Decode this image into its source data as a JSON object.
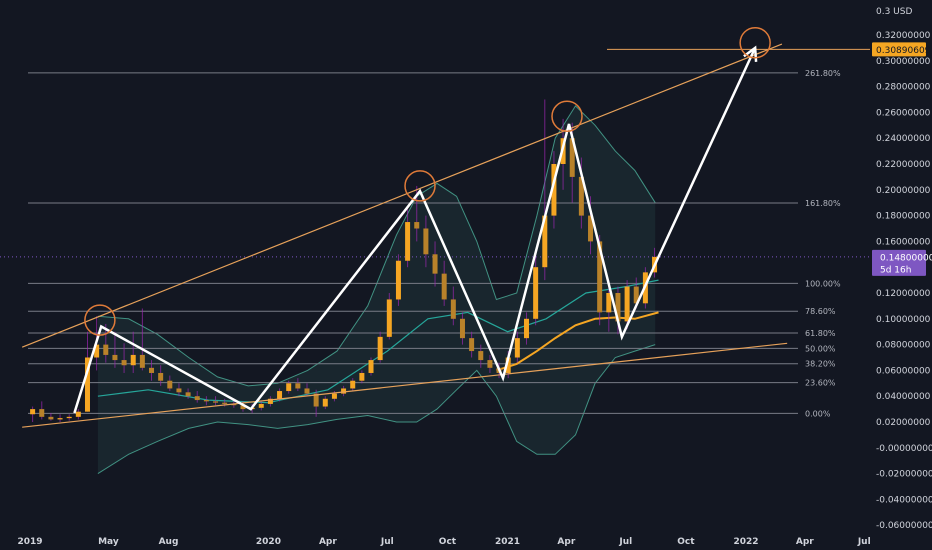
{
  "chart_data": {
    "type": "candlestick",
    "title": "",
    "xlabel": "",
    "ylabel": "",
    "currency": "USD",
    "ylim": [
      -0.066,
      0.3
    ],
    "y_ticks": [
      {
        "value": 0.3,
        "label": "0.3"
      },
      {
        "value": 0.32,
        "label": "0.32000000"
      },
      {
        "value": 0.3,
        "label": "0.30000000"
      },
      {
        "value": 0.28,
        "label": "0.28000000"
      },
      {
        "value": 0.26,
        "label": "0.26000000"
      },
      {
        "value": 0.24,
        "label": "0.24000000"
      },
      {
        "value": 0.22,
        "label": "0.22000000"
      },
      {
        "value": 0.2,
        "label": "0.20000000"
      },
      {
        "value": 0.18,
        "label": "0.18000000"
      },
      {
        "value": 0.16,
        "label": "0.16000000"
      },
      {
        "value": 0.12,
        "label": "0.12000000"
      },
      {
        "value": 0.1,
        "label": "0.10000000"
      },
      {
        "value": 0.08,
        "label": "0.08000000"
      },
      {
        "value": 0.06,
        "label": "0.06000000"
      },
      {
        "value": 0.04,
        "label": "0.04000000"
      },
      {
        "value": 0.02,
        "label": "0.02000000"
      },
      {
        "value": -0.0,
        "label": "-0.00000000"
      },
      {
        "value": -0.02,
        "label": "-0.02000000"
      },
      {
        "value": -0.04,
        "label": "-0.04000000"
      },
      {
        "value": -0.06,
        "label": "-0.06000000"
      }
    ],
    "x_ticks": [
      "2019",
      "May",
      "Aug",
      "2020",
      "Apr",
      "Jul",
      "Oct",
      "2021",
      "Apr",
      "Jul",
      "Oct",
      "2022",
      "Apr",
      "Jul"
    ],
    "x_tick_dates": [
      "2019-01-01",
      "2019-05-01",
      "2019-08-01",
      "2020-01-01",
      "2020-04-01",
      "2020-07-01",
      "2020-10-01",
      "2021-01-01",
      "2021-04-01",
      "2021-07-01",
      "2021-10-01",
      "2022-01-01",
      "2022-04-01",
      "2022-07-01"
    ],
    "fib_levels": [
      {
        "label": "261.80%",
        "value": 0.2906
      },
      {
        "label": "161.80%",
        "value": 0.1898
      },
      {
        "label": "100.00%",
        "value": 0.1275
      },
      {
        "label": "78.60%",
        "value": 0.1059
      },
      {
        "label": "61.80%",
        "value": 0.089
      },
      {
        "label": "50.00%",
        "value": 0.0771
      },
      {
        "label": "38.20%",
        "value": 0.0652
      },
      {
        "label": "23.60%",
        "value": 0.0505
      },
      {
        "label": "0.00%",
        "value": 0.0267
      }
    ],
    "target_price": {
      "label": "0.30890609",
      "value": 0.3089
    },
    "current_price": {
      "label": "0.14800000",
      "value": 0.148,
      "countdown": "5d 16h"
    },
    "zigzag": [
      {
        "date": "2019-03-10",
        "value": 0.027
      },
      {
        "date": "2019-04-20",
        "value": 0.094
      },
      {
        "date": "2019-12-05",
        "value": 0.03
      },
      {
        "date": "2020-08-20",
        "value": 0.199
      },
      {
        "date": "2020-12-25",
        "value": 0.054
      },
      {
        "date": "2021-04-05",
        "value": 0.251
      },
      {
        "date": "2021-06-25",
        "value": 0.086
      },
      {
        "date": "2021-08-20",
        "value": 0.148
      },
      {
        "date": "2022-01-15",
        "value": 0.31
      }
    ],
    "trendlines": [
      {
        "name": "upper",
        "from": {
          "date": "2018-12-20",
          "value": 0.078
        },
        "to": {
          "date": "2022-02-25",
          "value": 0.313
        }
      },
      {
        "name": "lower",
        "from": {
          "date": "2018-12-20",
          "value": 0.016
        },
        "to": {
          "date": "2022-03-05",
          "value": 0.081
        }
      }
    ],
    "circles": [
      {
        "date": "2019-04-18",
        "value": 0.099
      },
      {
        "date": "2020-08-20",
        "value": 0.203
      },
      {
        "date": "2021-04-02",
        "value": 0.257
      },
      {
        "date": "2022-01-15",
        "value": 0.314
      }
    ],
    "bollinger_upper": [
      {
        "date": "2019-04-15",
        "value": 0.102
      },
      {
        "date": "2019-06-01",
        "value": 0.1
      },
      {
        "date": "2019-07-15",
        "value": 0.088
      },
      {
        "date": "2019-09-01",
        "value": 0.07
      },
      {
        "date": "2019-10-15",
        "value": 0.055
      },
      {
        "date": "2019-12-01",
        "value": 0.048
      },
      {
        "date": "2020-01-15",
        "value": 0.05
      },
      {
        "date": "2020-03-01",
        "value": 0.06
      },
      {
        "date": "2020-04-15",
        "value": 0.075
      },
      {
        "date": "2020-06-01",
        "value": 0.11
      },
      {
        "date": "2020-07-15",
        "value": 0.165
      },
      {
        "date": "2020-08-15",
        "value": 0.195
      },
      {
        "date": "2020-09-15",
        "value": 0.205
      },
      {
        "date": "2020-10-15",
        "value": 0.195
      },
      {
        "date": "2020-11-15",
        "value": 0.16
      },
      {
        "date": "2020-12-15",
        "value": 0.115
      },
      {
        "date": "2021-01-15",
        "value": 0.12
      },
      {
        "date": "2021-02-15",
        "value": 0.18
      },
      {
        "date": "2021-03-15",
        "value": 0.24
      },
      {
        "date": "2021-04-15",
        "value": 0.265
      },
      {
        "date": "2021-05-15",
        "value": 0.25
      },
      {
        "date": "2021-06-15",
        "value": 0.23
      },
      {
        "date": "2021-07-15",
        "value": 0.215
      },
      {
        "date": "2021-08-15",
        "value": 0.19
      }
    ],
    "bollinger_lower": [
      {
        "date": "2019-04-15",
        "value": -0.02
      },
      {
        "date": "2019-06-01",
        "value": -0.005
      },
      {
        "date": "2019-07-15",
        "value": 0.005
      },
      {
        "date": "2019-09-01",
        "value": 0.015
      },
      {
        "date": "2019-10-15",
        "value": 0.02
      },
      {
        "date": "2019-12-01",
        "value": 0.018
      },
      {
        "date": "2020-01-15",
        "value": 0.015
      },
      {
        "date": "2020-03-01",
        "value": 0.018
      },
      {
        "date": "2020-04-15",
        "value": 0.022
      },
      {
        "date": "2020-06-01",
        "value": 0.025
      },
      {
        "date": "2020-07-15",
        "value": 0.02
      },
      {
        "date": "2020-08-15",
        "value": 0.02
      },
      {
        "date": "2020-09-15",
        "value": 0.03
      },
      {
        "date": "2020-10-15",
        "value": 0.045
      },
      {
        "date": "2020-11-15",
        "value": 0.06
      },
      {
        "date": "2020-12-15",
        "value": 0.04
      },
      {
        "date": "2021-01-15",
        "value": 0.005
      },
      {
        "date": "2021-02-15",
        "value": -0.005
      },
      {
        "date": "2021-03-15",
        "value": -0.005
      },
      {
        "date": "2021-04-15",
        "value": 0.01
      },
      {
        "date": "2021-05-15",
        "value": 0.05
      },
      {
        "date": "2021-06-15",
        "value": 0.07
      },
      {
        "date": "2021-07-15",
        "value": 0.075
      },
      {
        "date": "2021-08-15",
        "value": 0.08
      }
    ],
    "ma_teal": [
      {
        "date": "2019-04-15",
        "value": 0.04
      },
      {
        "date": "2019-07-01",
        "value": 0.045
      },
      {
        "date": "2019-10-01",
        "value": 0.037
      },
      {
        "date": "2020-01-01",
        "value": 0.035
      },
      {
        "date": "2020-04-01",
        "value": 0.045
      },
      {
        "date": "2020-07-01",
        "value": 0.075
      },
      {
        "date": "2020-09-01",
        "value": 0.1
      },
      {
        "date": "2020-11-01",
        "value": 0.105
      },
      {
        "date": "2021-01-01",
        "value": 0.09
      },
      {
        "date": "2021-03-01",
        "value": 0.1
      },
      {
        "date": "2021-05-01",
        "value": 0.12
      },
      {
        "date": "2021-07-01",
        "value": 0.125
      },
      {
        "date": "2021-08-20",
        "value": 0.13
      }
    ],
    "ma_orange": [
      {
        "date": "2020-12-15",
        "value": 0.06
      },
      {
        "date": "2021-01-15",
        "value": 0.065
      },
      {
        "date": "2021-02-15",
        "value": 0.075
      },
      {
        "date": "2021-03-15",
        "value": 0.085
      },
      {
        "date": "2021-04-15",
        "value": 0.095
      },
      {
        "date": "2021-05-15",
        "value": 0.1
      },
      {
        "date": "2021-06-15",
        "value": 0.101
      },
      {
        "date": "2021-07-15",
        "value": 0.1
      },
      {
        "date": "2021-08-20",
        "value": 0.105
      }
    ],
    "candles": [
      {
        "date": "2019-01-05",
        "o": 0.026,
        "h": 0.032,
        "l": 0.02,
        "c": 0.03
      },
      {
        "date": "2019-01-19",
        "o": 0.03,
        "h": 0.036,
        "l": 0.022,
        "c": 0.024
      },
      {
        "date": "2019-02-02",
        "o": 0.024,
        "h": 0.027,
        "l": 0.021,
        "c": 0.022
      },
      {
        "date": "2019-02-16",
        "o": 0.022,
        "h": 0.026,
        "l": 0.02,
        "c": 0.023
      },
      {
        "date": "2019-03-02",
        "o": 0.023,
        "h": 0.026,
        "l": 0.021,
        "c": 0.024
      },
      {
        "date": "2019-03-16",
        "o": 0.024,
        "h": 0.03,
        "l": 0.022,
        "c": 0.028
      },
      {
        "date": "2019-03-30",
        "o": 0.028,
        "h": 0.09,
        "l": 0.028,
        "c": 0.07
      },
      {
        "date": "2019-04-13",
        "o": 0.07,
        "h": 0.102,
        "l": 0.06,
        "c": 0.08
      },
      {
        "date": "2019-04-27",
        "o": 0.08,
        "h": 0.096,
        "l": 0.066,
        "c": 0.072
      },
      {
        "date": "2019-05-11",
        "o": 0.072,
        "h": 0.09,
        "l": 0.062,
        "c": 0.068
      },
      {
        "date": "2019-05-25",
        "o": 0.068,
        "h": 0.081,
        "l": 0.058,
        "c": 0.064
      },
      {
        "date": "2019-06-08",
        "o": 0.064,
        "h": 0.09,
        "l": 0.058,
        "c": 0.072
      },
      {
        "date": "2019-06-22",
        "o": 0.072,
        "h": 0.108,
        "l": 0.06,
        "c": 0.062
      },
      {
        "date": "2019-07-06",
        "o": 0.062,
        "h": 0.068,
        "l": 0.052,
        "c": 0.058
      },
      {
        "date": "2019-07-20",
        "o": 0.058,
        "h": 0.064,
        "l": 0.048,
        "c": 0.052
      },
      {
        "date": "2019-08-03",
        "o": 0.052,
        "h": 0.056,
        "l": 0.044,
        "c": 0.046
      },
      {
        "date": "2019-08-17",
        "o": 0.046,
        "h": 0.05,
        "l": 0.04,
        "c": 0.043
      },
      {
        "date": "2019-08-31",
        "o": 0.043,
        "h": 0.046,
        "l": 0.038,
        "c": 0.04
      },
      {
        "date": "2019-09-14",
        "o": 0.04,
        "h": 0.044,
        "l": 0.035,
        "c": 0.037
      },
      {
        "date": "2019-09-28",
        "o": 0.037,
        "h": 0.04,
        "l": 0.033,
        "c": 0.036
      },
      {
        "date": "2019-10-12",
        "o": 0.036,
        "h": 0.04,
        "l": 0.033,
        "c": 0.035
      },
      {
        "date": "2019-10-26",
        "o": 0.035,
        "h": 0.038,
        "l": 0.032,
        "c": 0.034
      },
      {
        "date": "2019-11-09",
        "o": 0.034,
        "h": 0.038,
        "l": 0.031,
        "c": 0.033
      },
      {
        "date": "2019-11-23",
        "o": 0.033,
        "h": 0.036,
        "l": 0.028,
        "c": 0.03
      },
      {
        "date": "2019-12-07",
        "o": 0.03,
        "h": 0.034,
        "l": 0.027,
        "c": 0.031
      },
      {
        "date": "2019-12-21",
        "o": 0.031,
        "h": 0.036,
        "l": 0.029,
        "c": 0.034
      },
      {
        "date": "2020-01-04",
        "o": 0.034,
        "h": 0.04,
        "l": 0.032,
        "c": 0.038
      },
      {
        "date": "2020-01-18",
        "o": 0.038,
        "h": 0.046,
        "l": 0.036,
        "c": 0.044
      },
      {
        "date": "2020-02-01",
        "o": 0.044,
        "h": 0.052,
        "l": 0.042,
        "c": 0.05
      },
      {
        "date": "2020-02-15",
        "o": 0.05,
        "h": 0.054,
        "l": 0.044,
        "c": 0.046
      },
      {
        "date": "2020-02-29",
        "o": 0.046,
        "h": 0.05,
        "l": 0.04,
        "c": 0.042
      },
      {
        "date": "2020-03-14",
        "o": 0.042,
        "h": 0.045,
        "l": 0.024,
        "c": 0.032
      },
      {
        "date": "2020-03-28",
        "o": 0.032,
        "h": 0.04,
        "l": 0.03,
        "c": 0.038
      },
      {
        "date": "2020-04-11",
        "o": 0.038,
        "h": 0.044,
        "l": 0.036,
        "c": 0.042
      },
      {
        "date": "2020-04-25",
        "o": 0.042,
        "h": 0.048,
        "l": 0.04,
        "c": 0.046
      },
      {
        "date": "2020-05-09",
        "o": 0.046,
        "h": 0.054,
        "l": 0.044,
        "c": 0.052
      },
      {
        "date": "2020-05-23",
        "o": 0.052,
        "h": 0.06,
        "l": 0.05,
        "c": 0.058
      },
      {
        "date": "2020-06-06",
        "o": 0.058,
        "h": 0.07,
        "l": 0.056,
        "c": 0.068
      },
      {
        "date": "2020-06-20",
        "o": 0.068,
        "h": 0.09,
        "l": 0.066,
        "c": 0.086
      },
      {
        "date": "2020-07-04",
        "o": 0.086,
        "h": 0.12,
        "l": 0.084,
        "c": 0.115
      },
      {
        "date": "2020-07-18",
        "o": 0.115,
        "h": 0.15,
        "l": 0.11,
        "c": 0.145
      },
      {
        "date": "2020-08-01",
        "o": 0.145,
        "h": 0.185,
        "l": 0.14,
        "c": 0.175
      },
      {
        "date": "2020-08-15",
        "o": 0.175,
        "h": 0.203,
        "l": 0.16,
        "c": 0.17
      },
      {
        "date": "2020-08-29",
        "o": 0.17,
        "h": 0.18,
        "l": 0.14,
        "c": 0.15
      },
      {
        "date": "2020-09-12",
        "o": 0.15,
        "h": 0.16,
        "l": 0.125,
        "c": 0.135
      },
      {
        "date": "2020-09-26",
        "o": 0.135,
        "h": 0.145,
        "l": 0.11,
        "c": 0.115
      },
      {
        "date": "2020-10-10",
        "o": 0.115,
        "h": 0.125,
        "l": 0.095,
        "c": 0.1
      },
      {
        "date": "2020-10-24",
        "o": 0.1,
        "h": 0.105,
        "l": 0.08,
        "c": 0.085
      },
      {
        "date": "2020-11-07",
        "o": 0.085,
        "h": 0.09,
        "l": 0.07,
        "c": 0.075
      },
      {
        "date": "2020-11-21",
        "o": 0.075,
        "h": 0.08,
        "l": 0.062,
        "c": 0.068
      },
      {
        "date": "2020-12-05",
        "o": 0.068,
        "h": 0.072,
        "l": 0.058,
        "c": 0.062
      },
      {
        "date": "2020-12-19",
        "o": 0.062,
        "h": 0.066,
        "l": 0.054,
        "c": 0.058
      },
      {
        "date": "2021-01-02",
        "o": 0.058,
        "h": 0.075,
        "l": 0.054,
        "c": 0.07
      },
      {
        "date": "2021-01-16",
        "o": 0.07,
        "h": 0.09,
        "l": 0.066,
        "c": 0.085
      },
      {
        "date": "2021-01-30",
        "o": 0.085,
        "h": 0.105,
        "l": 0.08,
        "c": 0.1
      },
      {
        "date": "2021-02-13",
        "o": 0.1,
        "h": 0.15,
        "l": 0.095,
        "c": 0.14
      },
      {
        "date": "2021-02-27",
        "o": 0.14,
        "h": 0.27,
        "l": 0.13,
        "c": 0.18
      },
      {
        "date": "2021-03-13",
        "o": 0.18,
        "h": 0.23,
        "l": 0.17,
        "c": 0.22
      },
      {
        "date": "2021-03-27",
        "o": 0.22,
        "h": 0.255,
        "l": 0.2,
        "c": 0.24
      },
      {
        "date": "2021-04-10",
        "o": 0.24,
        "h": 0.252,
        "l": 0.19,
        "c": 0.21
      },
      {
        "date": "2021-04-24",
        "o": 0.21,
        "h": 0.225,
        "l": 0.17,
        "c": 0.18
      },
      {
        "date": "2021-05-08",
        "o": 0.18,
        "h": 0.195,
        "l": 0.15,
        "c": 0.16
      },
      {
        "date": "2021-05-22",
        "o": 0.16,
        "h": 0.165,
        "l": 0.095,
        "c": 0.105
      },
      {
        "date": "2021-06-05",
        "o": 0.105,
        "h": 0.13,
        "l": 0.09,
        "c": 0.12
      },
      {
        "date": "2021-06-19",
        "o": 0.12,
        "h": 0.125,
        "l": 0.088,
        "c": 0.098
      },
      {
        "date": "2021-07-03",
        "o": 0.098,
        "h": 0.13,
        "l": 0.092,
        "c": 0.125
      },
      {
        "date": "2021-07-17",
        "o": 0.125,
        "h": 0.132,
        "l": 0.108,
        "c": 0.112
      },
      {
        "date": "2021-07-31",
        "o": 0.112,
        "h": 0.14,
        "l": 0.108,
        "c": 0.136
      },
      {
        "date": "2021-08-14",
        "o": 0.136,
        "h": 0.155,
        "l": 0.132,
        "c": 0.148
      }
    ],
    "colors": {
      "background": "#131722",
      "candle": "#f5a623",
      "candle_dim": "#b9822a",
      "overlay_purple": "#9c27b0",
      "zigzag": "#ffffff",
      "trendline": "#e6a15a",
      "fib_line": "#787b86",
      "band": "#4caf9a",
      "ma_teal": "#26a69a",
      "ma_orange": "#f5a623",
      "circle": "#e07b39",
      "price_label_bg": "#f5a623",
      "current_label_bg": "#7e57c2"
    }
  }
}
